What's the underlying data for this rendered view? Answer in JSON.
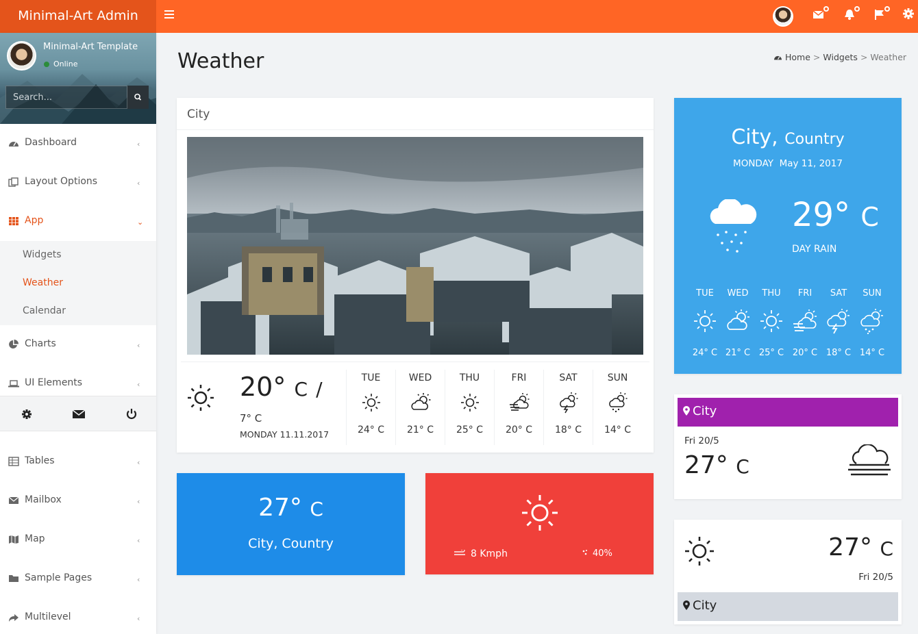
{
  "app": {
    "brand": "Minimal-Art Admin"
  },
  "user": {
    "name": "Minimal-Art Template",
    "status": "Online"
  },
  "search": {
    "placeholder": "Search..."
  },
  "sidebar": {
    "items": [
      {
        "label": "Dashboard",
        "icon": "dashboard-icon"
      },
      {
        "label": "Layout Options",
        "icon": "copy-icon"
      },
      {
        "label": "App",
        "icon": "grid-icon"
      },
      {
        "label": "Charts",
        "icon": "pie-chart-icon"
      },
      {
        "label": "UI Elements",
        "icon": "laptop-icon"
      },
      {
        "label": "Tables",
        "icon": "table-icon"
      },
      {
        "label": "Mailbox",
        "icon": "envelope-icon"
      },
      {
        "label": "Map",
        "icon": "map-icon"
      },
      {
        "label": "Sample Pages",
        "icon": "folder-icon"
      },
      {
        "label": "Multilevel",
        "icon": "share-icon"
      }
    ],
    "submenu": [
      "Widgets",
      "Weather",
      "Calendar"
    ]
  },
  "page": {
    "title": "Weather",
    "breadcrumb": [
      "Home",
      "Widgets",
      "Weather"
    ]
  },
  "city_card": {
    "title": "City",
    "temp": "20°",
    "unit": "C",
    "slash": "/",
    "low": "7° C",
    "date": "MONDAY 11.11.2017",
    "forecast": [
      {
        "day": "TUE",
        "temp": "24° C",
        "icon": "sunny-icon"
      },
      {
        "day": "WED",
        "temp": "21° C",
        "icon": "partly-cloudy-icon"
      },
      {
        "day": "THU",
        "temp": "25° C",
        "icon": "sunny-icon"
      },
      {
        "day": "FRI",
        "temp": "20° C",
        "icon": "windy-cloud-icon"
      },
      {
        "day": "SAT",
        "temp": "18° C",
        "icon": "thunderstorm-icon"
      },
      {
        "day": "SUN",
        "temp": "14° C",
        "icon": "rain-sun-icon"
      }
    ]
  },
  "blue_card": {
    "temp": "27°",
    "unit": "C",
    "location": "City, Country"
  },
  "red_card": {
    "wind": "8 Kmph",
    "humidity": "40%"
  },
  "sky_card": {
    "city": "City,",
    "country": "Country",
    "weekday": "MONDAY",
    "date": "May 11, 2017",
    "temp": "29°",
    "unit": "C",
    "condition": "DAY RAIN",
    "forecast": [
      {
        "day": "TUE",
        "temp": "24° C",
        "icon": "sunny-icon"
      },
      {
        "day": "WED",
        "temp": "21° C",
        "icon": "partly-cloudy-icon"
      },
      {
        "day": "THU",
        "temp": "25° C",
        "icon": "sunny-icon"
      },
      {
        "day": "FRI",
        "temp": "20° C",
        "icon": "windy-cloud-icon"
      },
      {
        "day": "SAT",
        "temp": "18° C",
        "icon": "thunderstorm-icon"
      },
      {
        "day": "SUN",
        "temp": "14° C",
        "icon": "rain-sun-icon"
      }
    ]
  },
  "purple_card": {
    "city": "City",
    "date": "Fri 20/5",
    "temp": "27°",
    "unit": "C"
  },
  "white_card": {
    "city": "City",
    "date": "Fri 20/5",
    "temp": "27°",
    "unit": "C"
  },
  "colors": {
    "topbar": "#ff6525",
    "brand": "#e4541b",
    "accent": "#e4541b",
    "blue_card": "#1e8ce8",
    "red_card": "#f0403a",
    "sky_card": "#3ea6ea",
    "purple_card": "#a021ad"
  }
}
